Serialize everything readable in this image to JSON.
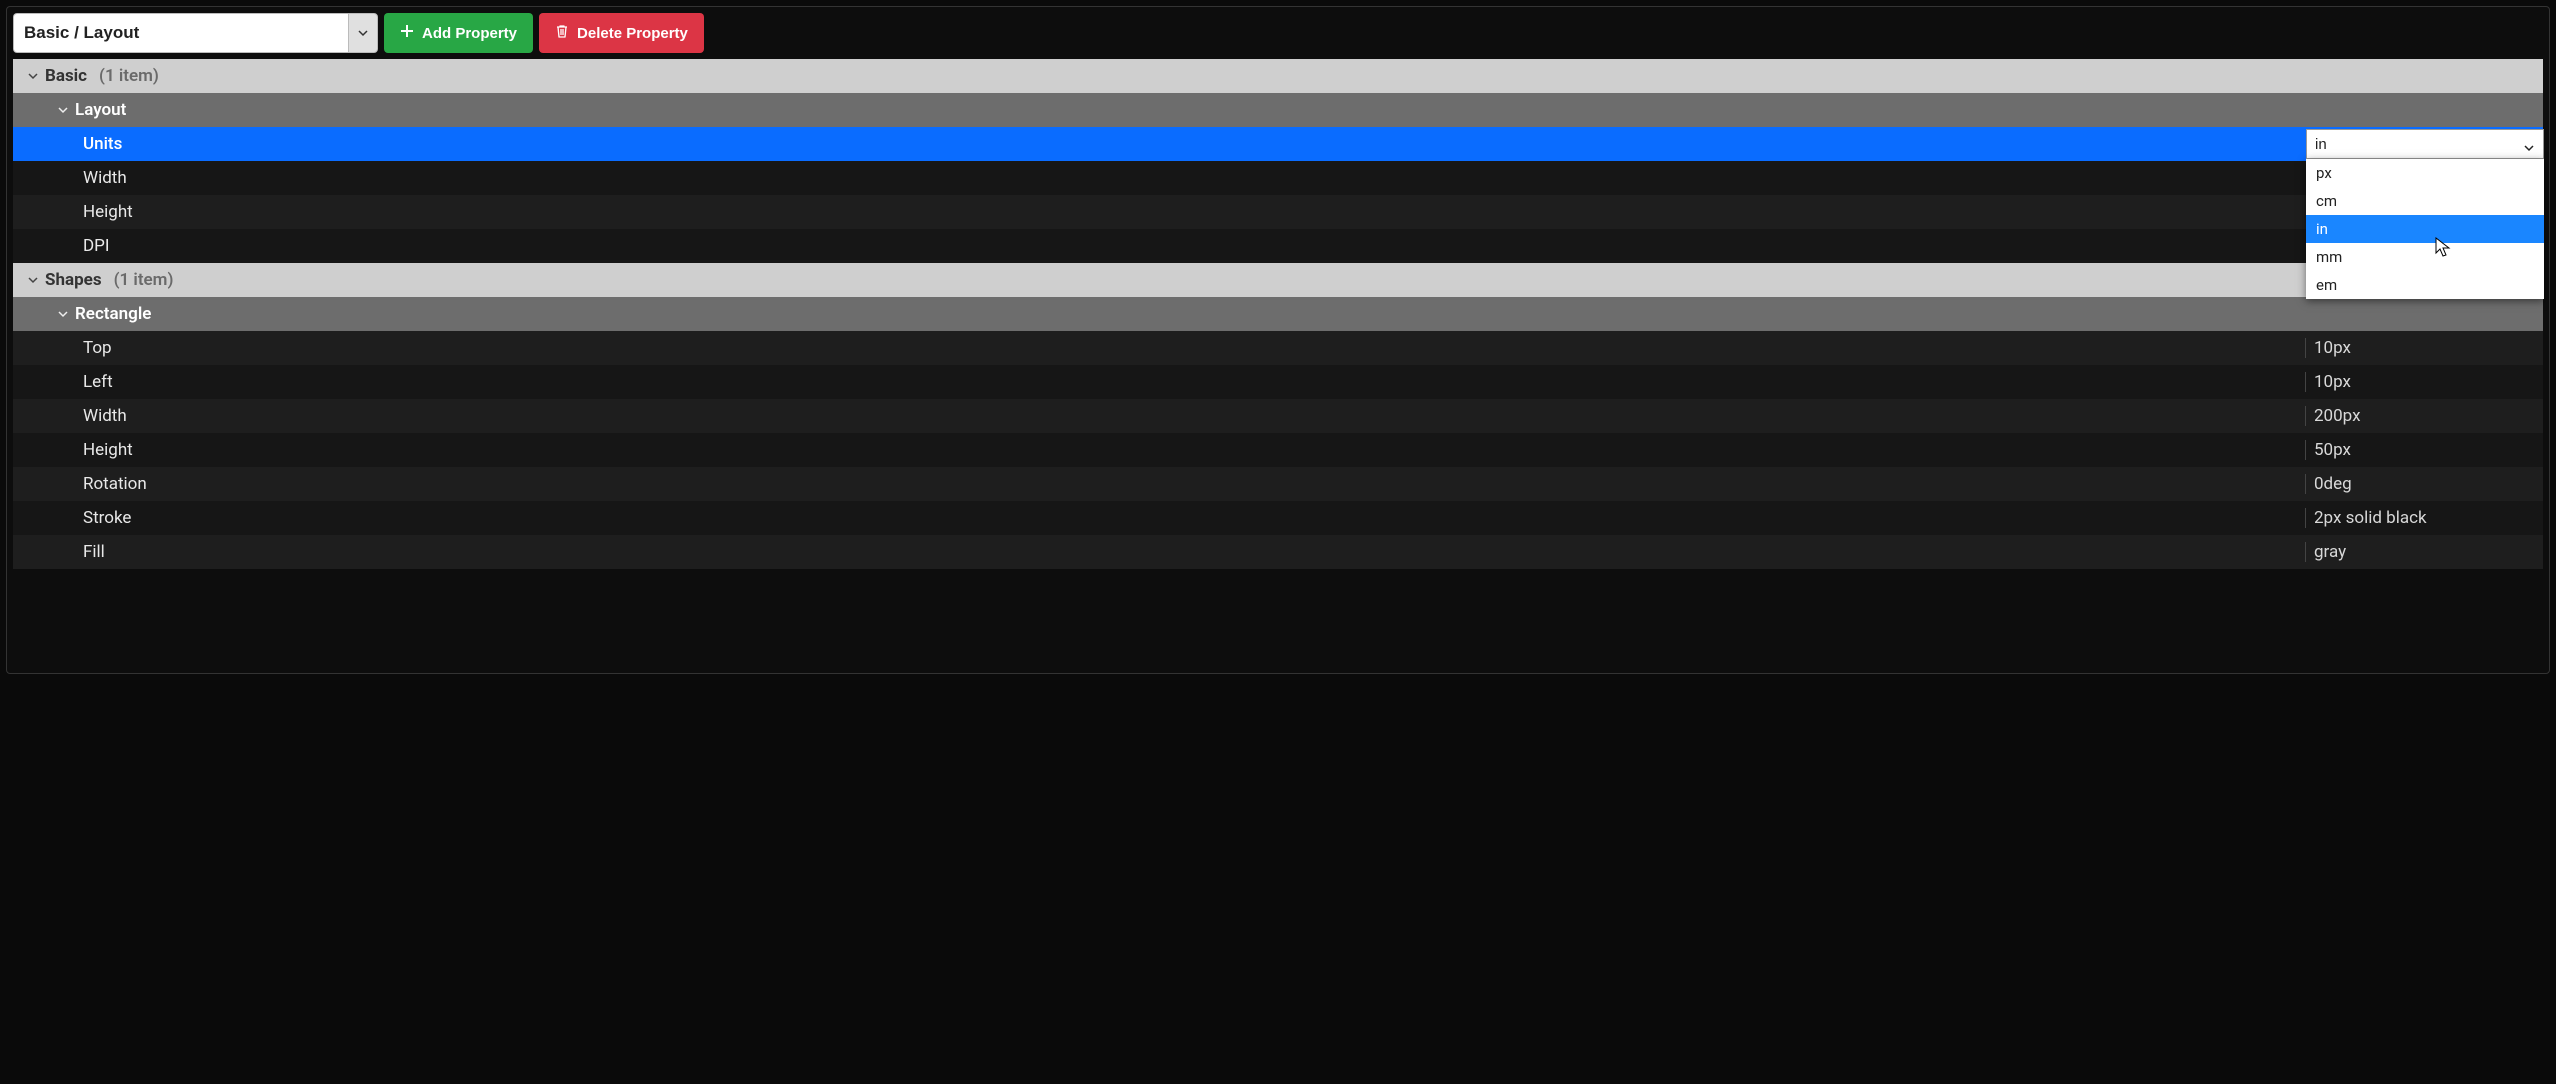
{
  "toolbar": {
    "path_value": "Basic / Layout",
    "add_label": "Add Property",
    "delete_label": "Delete Property"
  },
  "sections": [
    {
      "title": "Basic",
      "count_text": "(1 item)",
      "groups": [
        {
          "title": "Layout",
          "props": [
            {
              "name": "Units",
              "value": "in",
              "selected": true,
              "editing": true
            },
            {
              "name": "Width",
              "value": ""
            },
            {
              "name": "Height",
              "value": ""
            },
            {
              "name": "DPI",
              "value": ""
            }
          ]
        }
      ]
    },
    {
      "title": "Shapes",
      "count_text": "(1 item)",
      "groups": [
        {
          "title": "Rectangle",
          "props": [
            {
              "name": "Top",
              "value": "10px"
            },
            {
              "name": "Left",
              "value": "10px"
            },
            {
              "name": "Width",
              "value": "200px"
            },
            {
              "name": "Height",
              "value": "50px"
            },
            {
              "name": "Rotation",
              "value": "0deg"
            },
            {
              "name": "Stroke",
              "value": "2px solid black"
            },
            {
              "name": "Fill",
              "value": "gray"
            }
          ]
        }
      ]
    }
  ],
  "units_dropdown": {
    "current": "in",
    "options": [
      "px",
      "cm",
      "in",
      "mm",
      "em"
    ],
    "highlighted": "in"
  }
}
